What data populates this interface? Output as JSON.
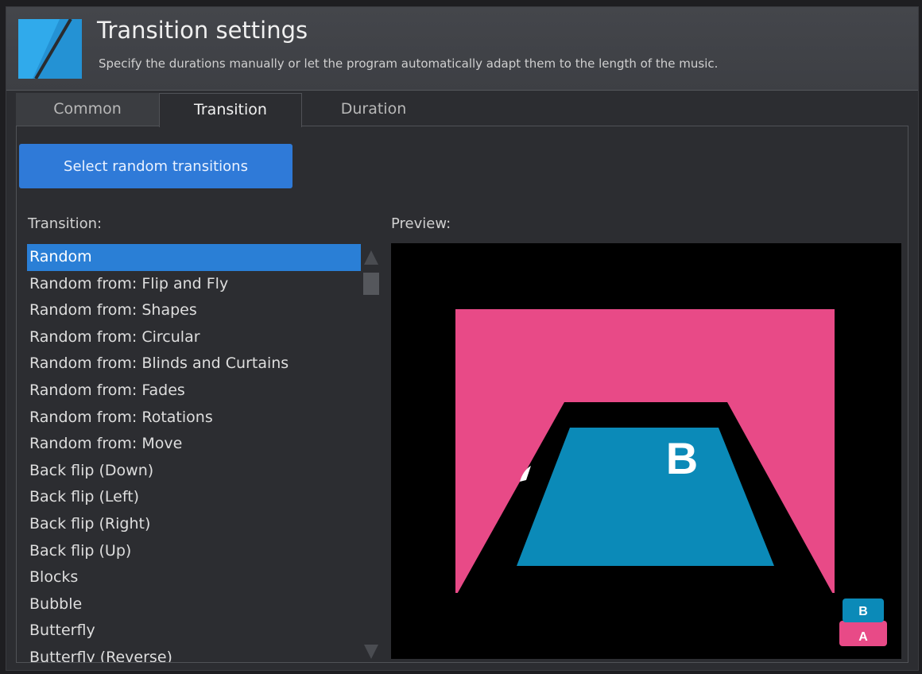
{
  "header": {
    "title": "Transition settings",
    "subtitle": "Specify the durations manually or let the program automatically adapt them to the length of the music."
  },
  "tabs": [
    {
      "label": "Common",
      "active": false
    },
    {
      "label": "Transition",
      "active": true
    },
    {
      "label": "Duration",
      "active": false
    }
  ],
  "random_button_label": "Select random transitions",
  "transition_label": "Transition:",
  "preview_label": "Preview:",
  "transitions": [
    "Random",
    "Random from: Flip and Fly",
    "Random from: Shapes",
    "Random from: Circular",
    "Random from: Blinds and Curtains",
    "Random from: Fades",
    "Random from: Rotations",
    "Random from: Move",
    "Back flip (Down)",
    "Back flip (Left)",
    "Back flip (Right)",
    "Back flip (Up)",
    "Blocks",
    "Bubble",
    "Butterfly",
    "Butterfly (Reverse)"
  ],
  "selected_transition": "Random",
  "preview": {
    "slide_a_letter": "A",
    "slide_b_letter": "B",
    "slide_a_color": "#e84a87",
    "slide_b_color": "#0b8ab8"
  },
  "ab_indicator": {
    "top": "B",
    "bottom": "A"
  },
  "colors": {
    "accent": "#2f7ad8",
    "selection": "#2a7fd6"
  }
}
